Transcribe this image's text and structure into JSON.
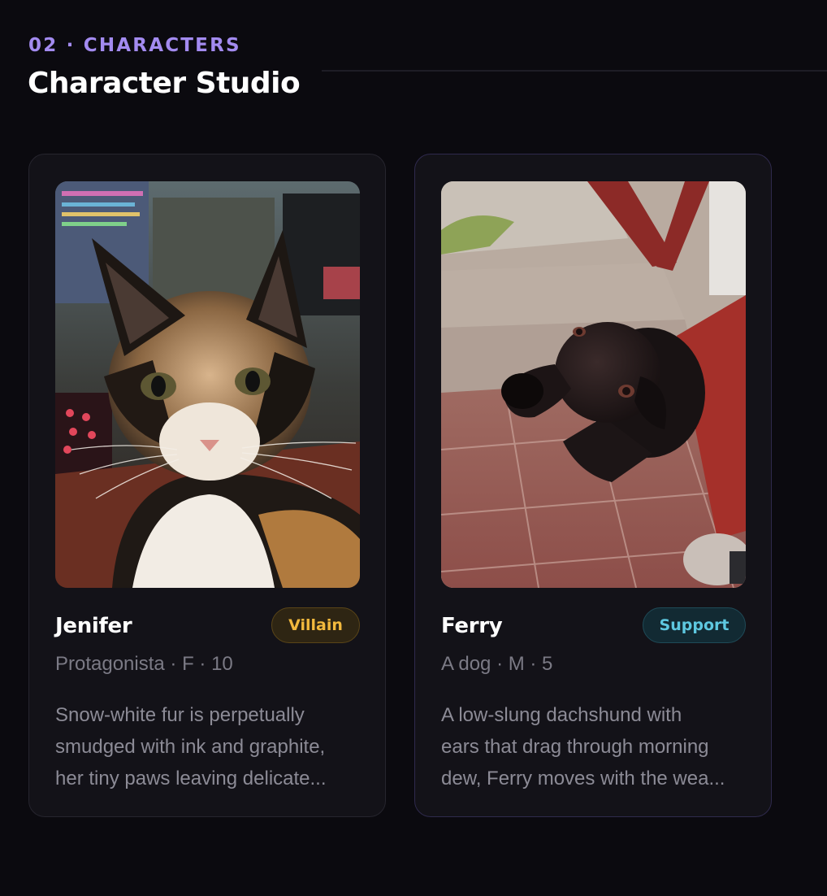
{
  "section": {
    "eyebrow": "02 · CHARACTERS",
    "title": "Character Studio"
  },
  "characters": [
    {
      "name": "Jenifer",
      "role": "Villain",
      "meta": "Protagonista · F · 10",
      "description_lines": [
        "Snow-white fur is perpetually",
        "smudged with ink and graphite,",
        "her tiny paws leaving delicate..."
      ],
      "photo": "calico-cat-photo",
      "badge_color": "#f2b93d"
    },
    {
      "name": "Ferry",
      "role": "Support",
      "meta": "A dog · M · 5",
      "description_lines": [
        "A low-slung dachshund with",
        "ears that drag through morning",
        "dew, Ferry moves with the wea..."
      ],
      "photo": "black-dog-photo",
      "badge_color": "#5ec8e0"
    }
  ]
}
